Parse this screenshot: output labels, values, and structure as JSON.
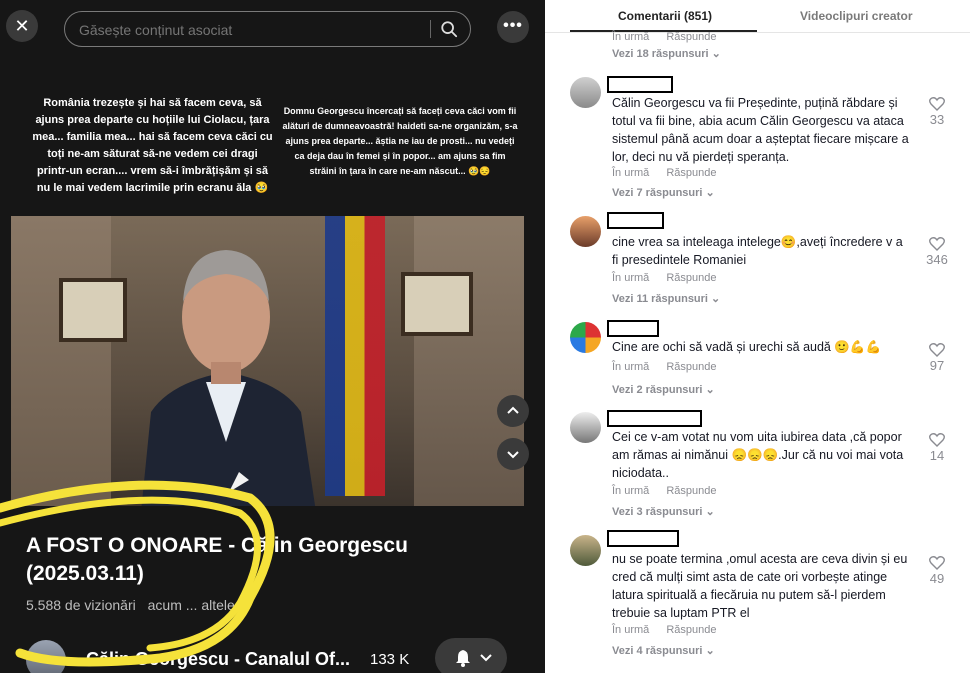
{
  "search": {
    "placeholder": "Găsește conținut asociat"
  },
  "overlay": {
    "left_text": "România trezește și hai să facem ceva, să ajuns prea departe cu hoțiile lui Ciolacu, țara mea... familia mea... hai să facem ceva căci cu toți ne-am săturat să-ne vedem cei dragi printr-un ecran.... vrem să-i îmbrățișăm și să nu le mai vedem lacrimile prin ecranu ăla 🥹",
    "right_text": "Domnu Georgescu încercați să faceți ceva căci vom fii alături de dumneavoastră! haideti sa-ne organizăm, s-a ajuns prea departe... ăștia ne iau de prosti... nu vedeți ca deja dau în femei și în popor... am ajuns sa fim străini în țara în care ne-am născut... 🥹😔"
  },
  "video": {
    "title": "A FOST O ONOARE - Călin Georgescu (2025.03.11)",
    "views": "5.588 de vizionări",
    "time_ago": "acum ... altele",
    "channel": "Călin Georgescu - Canalul Of...",
    "subscribers": "133 K"
  },
  "tabs": {
    "comments": "Comentarii (851)",
    "creator": "Videoclipuri creator"
  },
  "labels": {
    "in_urma": "În urmă",
    "raspunde": "Răspunde"
  },
  "top_replies": "Vezi 18 răspunsuri",
  "comments": [
    {
      "text": "Călin Georgescu va fii Președinte, puțină răbdare și totul va fii bine, abia acum Călin Georgescu va ataca sistemul până acum doar a așteptat fiecare mișcare a lor, deci nu vă pierdeți speranța.",
      "likes": "33",
      "replies": "Vezi 7 răspunsuri"
    },
    {
      "text": "cine vrea sa inteleaga intelege😊,aveți încredere v a fi presedintele Romaniei",
      "likes": "346",
      "replies": "Vezi 11 răspunsuri"
    },
    {
      "text": "Cine are ochi să vadă și urechi să audă 🙂💪💪",
      "likes": "97",
      "replies": "Vezi 2 răspunsuri"
    },
    {
      "text": "Cei ce v-am votat nu vom uita iubirea data ,că popor am rămas ai nimănui 😞😞😞.Jur că nu voi mai vota niciodata..",
      "likes": "14",
      "replies": "Vezi 3 răspunsuri"
    },
    {
      "text": "nu se poate termina ,omul acesta are ceva divin și eu cred că mulți simt asta de cate ori vorbește atinge latura spirituală a fiecăruia nu putem să-l pierdem trebuie sa luptam PTR el",
      "likes": "49",
      "replies": "Vezi 4 răspunsuri"
    }
  ],
  "colors": {
    "accent_highlight": "#f5e23a",
    "panel_dark": "#161616"
  }
}
